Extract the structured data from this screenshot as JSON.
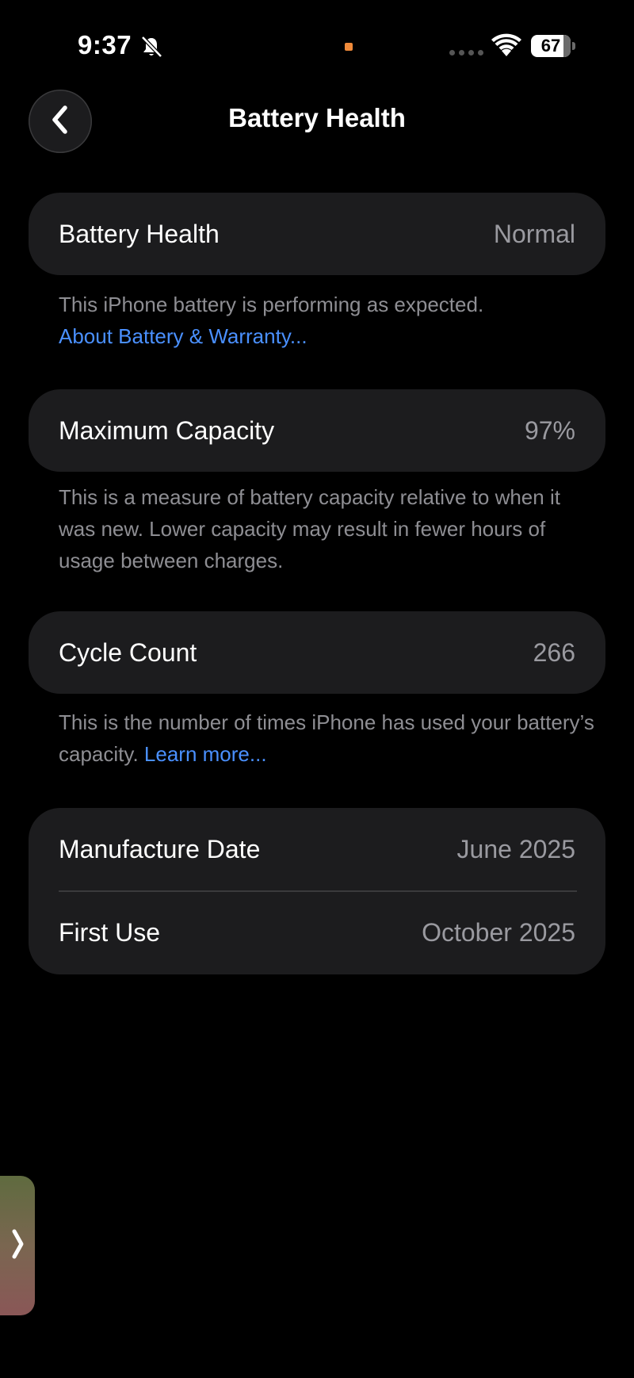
{
  "status_bar": {
    "time": "9:37",
    "battery_level": "67"
  },
  "nav": {
    "title": "Battery Health"
  },
  "battery_health": {
    "label": "Battery Health",
    "value": "Normal",
    "note": "This iPhone battery is performing as expected.",
    "link": "About Battery & Warranty..."
  },
  "max_capacity": {
    "label": "Maximum Capacity",
    "value": "97%",
    "note": "This is a measure of battery capacity relative to when it was new. Lower capacity may result in fewer hours of usage between charges."
  },
  "cycle_count": {
    "label": "Cycle Count",
    "value": "266",
    "note": "This is the number of times iPhone has used your battery’s capacity.",
    "link": "Learn more..."
  },
  "dates": {
    "manufacture_label": "Manufacture Date",
    "manufacture_value": "June 2025",
    "first_use_label": "First Use",
    "first_use_value": "October 2025"
  },
  "colors": {
    "background": "#000000",
    "card": "#1c1c1e",
    "secondary_text": "#8e8e93",
    "link": "#4a90ff",
    "recording_dot": "#f08a3a"
  },
  "icons": {
    "back": "chevron-left-icon",
    "silent": "bell-slash-icon",
    "wifi": "wifi-icon",
    "battery": "battery-icon",
    "side_tab": "chevron-right-icon"
  }
}
